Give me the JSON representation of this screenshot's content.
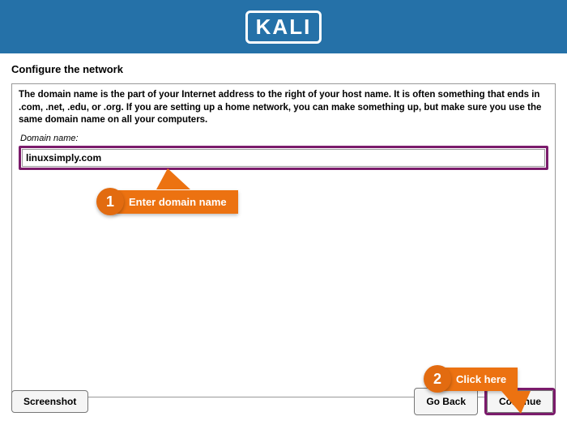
{
  "header": {
    "logo_text": "KALI"
  },
  "page": {
    "title": "Configure the network"
  },
  "main": {
    "description": "The domain name is the part of your Internet address to the right of your host name.  It is often something that ends in .com, .net, .edu, or .org.  If you are setting up a home network, you can make something up, but make sure you use the same domain name on all your computers.",
    "field_label": "Domain name:",
    "domain_value": "linuxsimply.com"
  },
  "callouts": {
    "one": {
      "number": "1",
      "text": "Enter domain name"
    },
    "two": {
      "number": "2",
      "text": "Click here"
    }
  },
  "buttons": {
    "screenshot": "Screenshot",
    "goback": "Go Back",
    "continue": "Continue"
  }
}
